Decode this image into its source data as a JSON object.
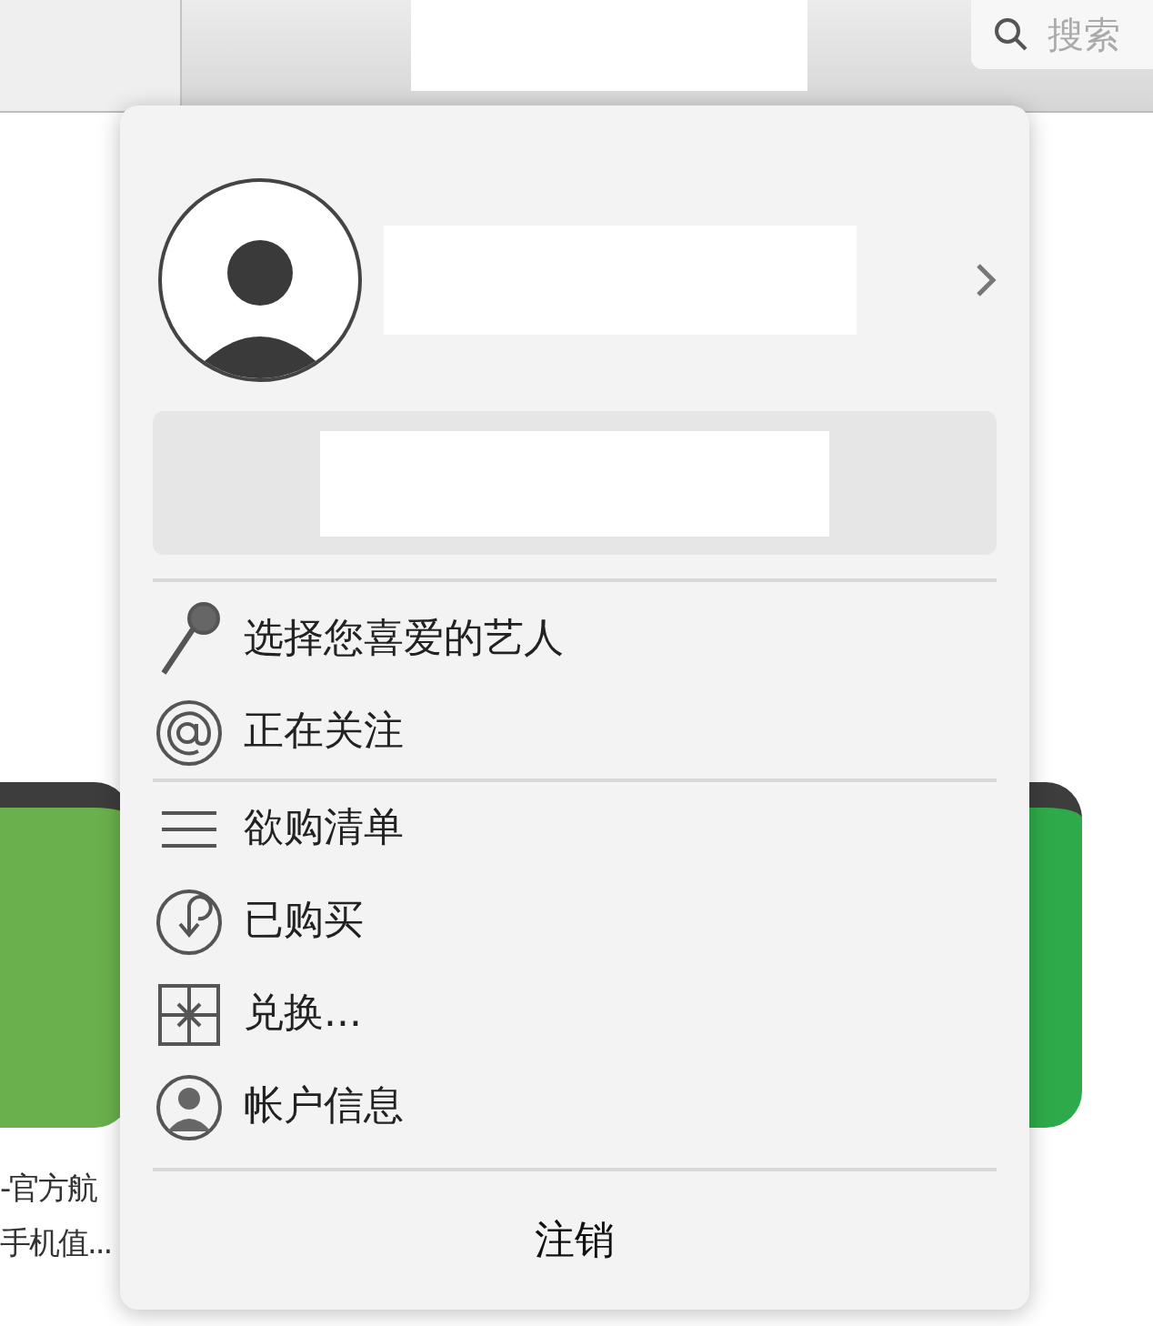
{
  "toolbar": {
    "search": {
      "placeholder": "搜索"
    }
  },
  "background_apps": [
    {
      "title_lines": [
        "-官方航",
        "手机值..."
      ]
    }
  ],
  "account_popover": {
    "menu_groups": [
      [
        {
          "label": "选择您喜爱的艺人"
        },
        {
          "label": "正在关注"
        }
      ],
      [
        {
          "label": "欲购清单"
        },
        {
          "label": "已购买"
        },
        {
          "label": "兑换..."
        },
        {
          "label": "帐户信息"
        }
      ]
    ],
    "sign_out": "注销"
  }
}
